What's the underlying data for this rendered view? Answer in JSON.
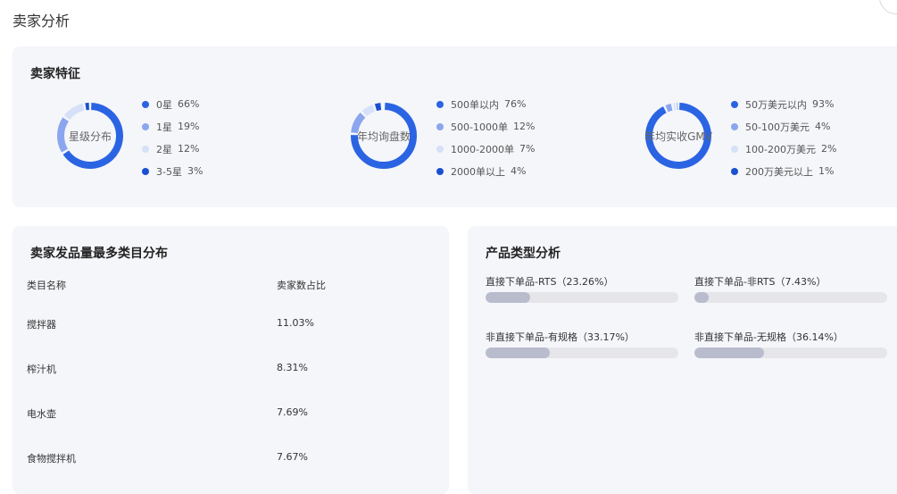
{
  "page_title": "卖家分析",
  "seller_features": {
    "title": "卖家特征",
    "donuts": [
      {
        "center_label": "星级分布",
        "items": [
          {
            "label": "0星",
            "value": "66%",
            "fraction": 0.66,
            "color": "#2b64e3"
          },
          {
            "label": "1星",
            "value": "19%",
            "fraction": 0.19,
            "color": "#8ba6ee"
          },
          {
            "label": "2星",
            "value": "12%",
            "fraction": 0.12,
            "color": "#d6e0f8"
          },
          {
            "label": "3-5星",
            "value": "3%",
            "fraction": 0.03,
            "color": "#1a4fd0"
          }
        ]
      },
      {
        "center_label": "年均询盘数",
        "items": [
          {
            "label": "500单以内",
            "value": "76%",
            "fraction": 0.76,
            "color": "#2b64e3"
          },
          {
            "label": "500-1000单",
            "value": "12%",
            "fraction": 0.12,
            "color": "#8ba6ee"
          },
          {
            "label": "1000-2000单",
            "value": "7%",
            "fraction": 0.07,
            "color": "#d6e0f8"
          },
          {
            "label": "2000单以上",
            "value": "4%",
            "fraction": 0.04,
            "color": "#1a4fd0"
          }
        ]
      },
      {
        "center_label": "年均实收GMV",
        "items": [
          {
            "label": "50万美元以内",
            "value": "93%",
            "fraction": 0.93,
            "color": "#2b64e3"
          },
          {
            "label": "50-100万美元",
            "value": "4%",
            "fraction": 0.04,
            "color": "#8ba6ee"
          },
          {
            "label": "100-200万美元",
            "value": "2%",
            "fraction": 0.02,
            "color": "#d6e0f8"
          },
          {
            "label": "200万美元以上",
            "value": "1%",
            "fraction": 0.01,
            "color": "#1a4fd0"
          }
        ]
      }
    ]
  },
  "top_categories": {
    "title": "卖家发品量最多类目分布",
    "columns": [
      "类目名称",
      "卖家数占比"
    ],
    "rows": [
      {
        "name": "搅拌器",
        "share": "11.03%"
      },
      {
        "name": "榨汁机",
        "share": "8.31%"
      },
      {
        "name": "电水壶",
        "share": "7.69%"
      },
      {
        "name": "食物搅拌机",
        "share": "7.67%"
      }
    ]
  },
  "product_types": {
    "title": "产品类型分析",
    "items": [
      {
        "label": "直接下单品-RTS（23.26%）",
        "fraction": 0.2326
      },
      {
        "label": "直接下单品-非RTS（7.43%）",
        "fraction": 0.0743
      },
      {
        "label": "非直接下单品-有规格（33.17%）",
        "fraction": 0.3317
      },
      {
        "label": "非直接下单品-无规格（36.14%）",
        "fraction": 0.3614
      }
    ]
  }
}
